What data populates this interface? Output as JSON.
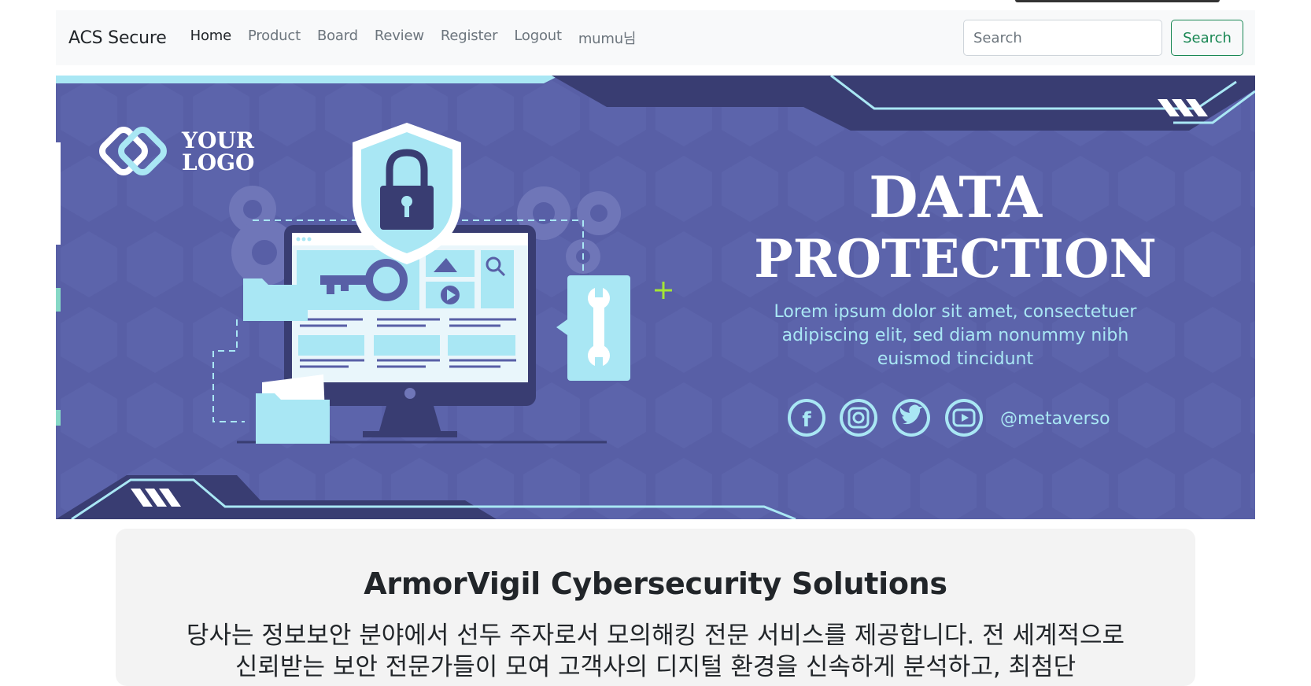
{
  "colors": {
    "navbar_bg": "#f8f9fa",
    "search_accent": "#198754",
    "banner_bg": "#585fa6",
    "banner_dark": "#393d72",
    "banner_light": "#a9e7f4",
    "content_bg": "#f3f3f3"
  },
  "navbar": {
    "brand": "ACS Secure",
    "items": [
      {
        "label": "Home",
        "active": true
      },
      {
        "label": "Product",
        "active": false
      },
      {
        "label": "Board",
        "active": false
      },
      {
        "label": "Review",
        "active": false
      },
      {
        "label": "Register",
        "active": false
      },
      {
        "label": "Logout",
        "active": false
      },
      {
        "label": "mumu님",
        "active": false
      }
    ],
    "search": {
      "placeholder": "Search",
      "button_label": "Search"
    }
  },
  "banner": {
    "logo_text_line1": "YOUR",
    "logo_text_line2": "LOGO",
    "headline_line1": "DATA",
    "headline_line2": "PROTECTION",
    "body_line1": "Lorem ipsum dolor sit amet, consectetuer",
    "body_line2": "adipiscing elit, sed diam nonummy nibh",
    "body_line3": "euismod tincidunt",
    "handle": "@metaverso",
    "social_icons": [
      "facebook-icon",
      "instagram-icon",
      "twitter-icon",
      "youtube-icon"
    ]
  },
  "content": {
    "title": "ArmorVigil Cybersecurity Solutions",
    "description": "당사는 정보보안 분야에서 선두 주자로서 모의해킹 전문 서비스를 제공합니다. 전 세계적으로 신뢰받는 보안 전문가들이 모여 고객사의 디지털 환경을 신속하게 분석하고, 최첨단"
  }
}
